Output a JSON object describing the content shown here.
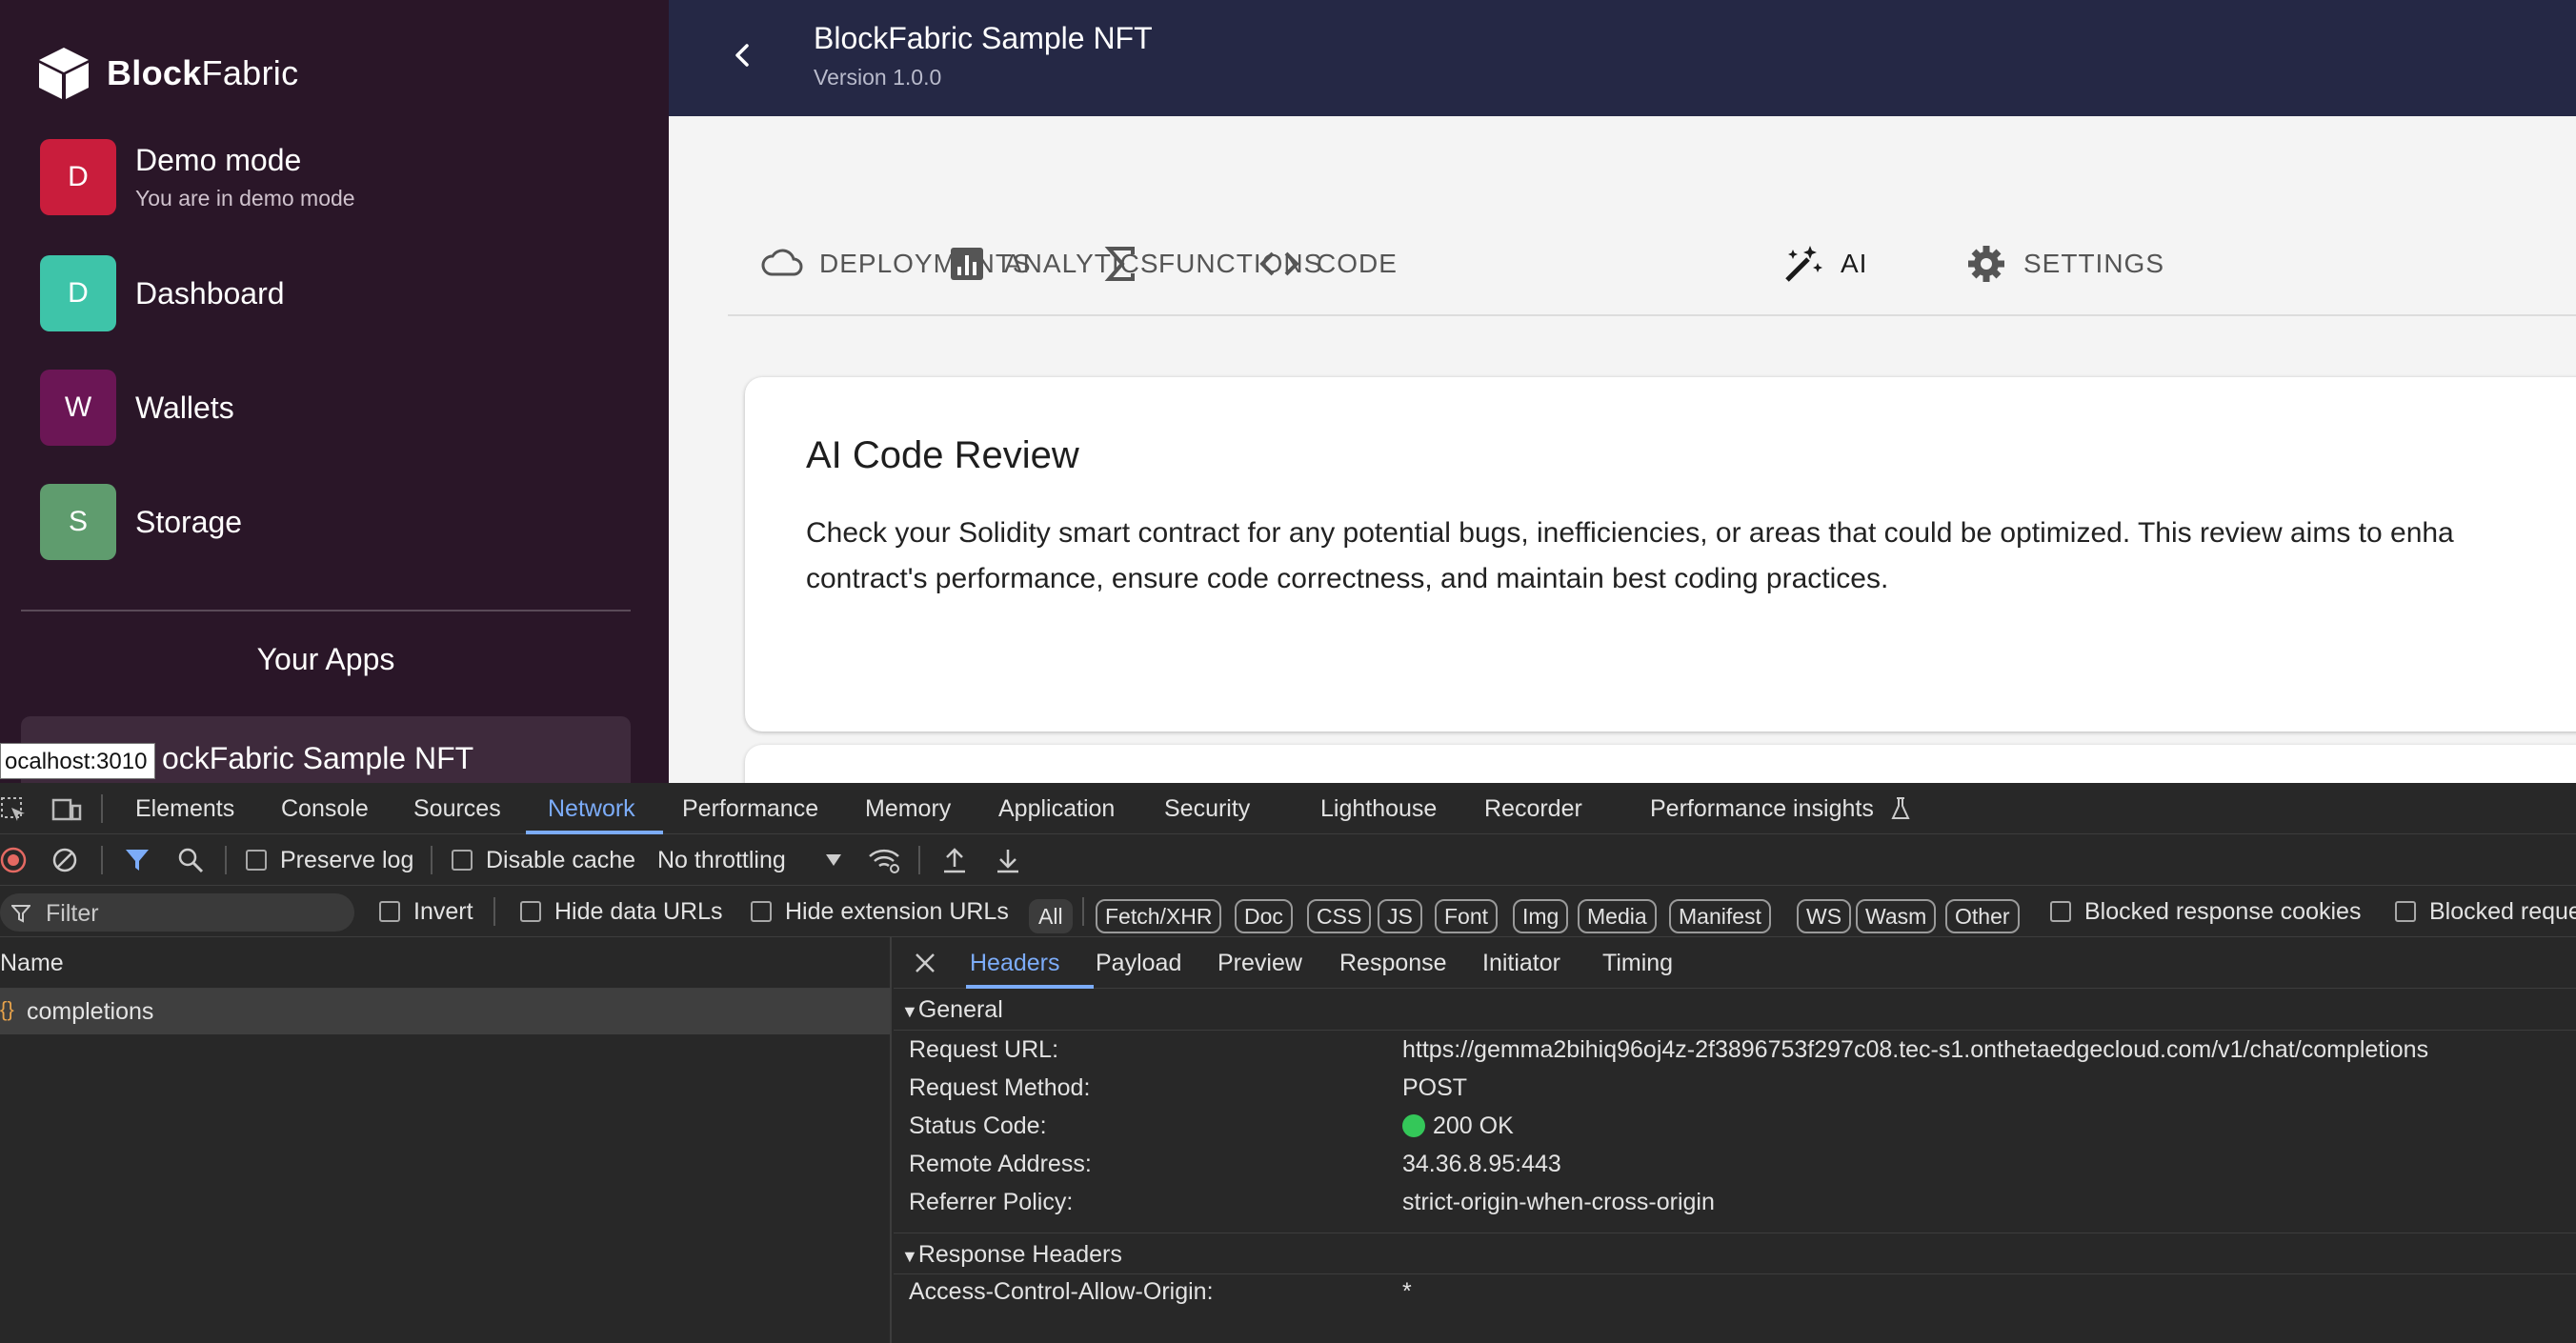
{
  "sidebar": {
    "brand_bold": "Block",
    "brand_light": "Fabric",
    "items": [
      {
        "avatar": "D",
        "label": "Demo mode",
        "sublabel": "You are in demo mode",
        "color": "#c91d3c"
      },
      {
        "avatar": "D",
        "label": "Dashboard",
        "color": "#3ec4a9"
      },
      {
        "avatar": "W",
        "label": "Wallets",
        "color": "#6b1655"
      },
      {
        "avatar": "S",
        "label": "Storage",
        "color": "#5f9c6e"
      }
    ],
    "your_apps": "Your Apps",
    "app_card_label": "ockFabric Sample NFT",
    "tooltip": "ocalhost:3010"
  },
  "header": {
    "title": "BlockFabric Sample NFT",
    "version": "Version 1.0.0"
  },
  "tabs": [
    {
      "label": "DEPLOYMENTS",
      "icon": "cloud-icon"
    },
    {
      "label": "ANALYTICS",
      "icon": "analytics-icon"
    },
    {
      "label": "FUNCTIONS",
      "icon": "sigma-icon"
    },
    {
      "label": "CODE",
      "icon": "code-icon"
    },
    {
      "label": "AI",
      "icon": "magic-wand-icon",
      "active": true
    },
    {
      "label": "SETTINGS",
      "icon": "gear-icon"
    }
  ],
  "card": {
    "title": "AI Code Review",
    "desc_line1": "Check your Solidity smart contract for any potential bugs, inefficiencies, or areas that could be optimized. This review aims to enha",
    "desc_line2": "contract's performance, ensure code correctness, and maintain best coding practices."
  },
  "devtools": {
    "tabs": [
      "Elements",
      "Console",
      "Sources",
      "Network",
      "Performance",
      "Memory",
      "Application",
      "Security",
      "Lighthouse",
      "Recorder",
      "Performance insights"
    ],
    "active_tab": "Network",
    "toolbar": {
      "preserve_log": "Preserve log",
      "disable_cache": "Disable cache",
      "throttling": "No throttling"
    },
    "filter": {
      "placeholder": "Filter",
      "invert": "Invert",
      "hide_data_urls": "Hide data URLs",
      "hide_extension_urls": "Hide extension URLs",
      "types": [
        "All",
        "Fetch/XHR",
        "Doc",
        "CSS",
        "JS",
        "Font",
        "Img",
        "Media",
        "Manifest",
        "WS",
        "Wasm",
        "Other"
      ],
      "blocked_cookies": "Blocked response cookies",
      "blocked_requests": "Blocked reque"
    },
    "requests": {
      "name_header": "Name",
      "rows": [
        "completions"
      ]
    },
    "details": {
      "tabs": [
        "Headers",
        "Payload",
        "Preview",
        "Response",
        "Initiator",
        "Timing"
      ],
      "active_tab": "Headers",
      "general_label": "General",
      "general": [
        {
          "key": "Request URL:",
          "value": "https://gemma2bihiq96oj4z-2f3896753f297c08.tec-s1.onthetaedgecloud.com/v1/chat/completions"
        },
        {
          "key": "Request Method:",
          "value": "POST"
        },
        {
          "key": "Status Code:",
          "value": "200 OK"
        },
        {
          "key": "Remote Address:",
          "value": "34.36.8.95:443"
        },
        {
          "key": "Referrer Policy:",
          "value": "strict-origin-when-cross-origin"
        }
      ],
      "response_headers_label": "Response Headers",
      "response_headers": [
        {
          "key": "Access-Control-Allow-Origin:",
          "value": "*"
        }
      ]
    }
  }
}
